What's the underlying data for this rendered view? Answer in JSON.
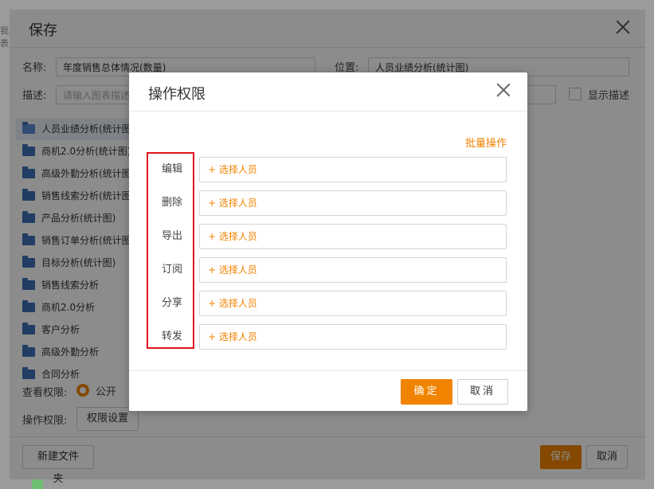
{
  "background": {
    "left_fragment": "我表"
  },
  "save_dialog": {
    "title": "保存",
    "name_label": "名称:",
    "name_value": "年度销售总体情况(数量)",
    "location_label": "位置:",
    "location_value": "人员业绩分析(统计图)",
    "desc_label": "描述:",
    "desc_placeholder": "请输入图表描述",
    "show_desc_label": "显示描述",
    "tree_items": [
      {
        "label": "人员业绩分析(统计图",
        "selected": true
      },
      {
        "label": "商机2.0分析(统计图)"
      },
      {
        "label": "高级外勤分析(统计图"
      },
      {
        "label": "销售线索分析(统计图"
      },
      {
        "label": "产品分析(统计图)"
      },
      {
        "label": "销售订单分析(统计图"
      },
      {
        "label": "目标分析(统计图)"
      },
      {
        "label": "销售线索分析"
      },
      {
        "label": "商机2.0分析"
      },
      {
        "label": "客户分析"
      },
      {
        "label": "高级外勤分析"
      },
      {
        "label": "合同分析"
      }
    ],
    "view_perm_label": "查看权限:",
    "view_perm_option": "公开",
    "op_perm_label": "操作权限:",
    "perm_settings_button": "权限设置",
    "new_folder_button": "新建文件夹",
    "save_button": "保存",
    "cancel_button": "取消"
  },
  "perm_modal": {
    "title": "操作权限",
    "batch_link": "批量操作",
    "rows": [
      {
        "label": "编辑",
        "placeholder": "+ 选择人员"
      },
      {
        "label": "删除",
        "placeholder": "+ 选择人员"
      },
      {
        "label": "导出",
        "placeholder": "+ 选择人员"
      },
      {
        "label": "订阅",
        "placeholder": "+ 选择人员"
      },
      {
        "label": "分享",
        "placeholder": "+ 选择人员"
      },
      {
        "label": "转发",
        "placeholder": "+ 选择人员"
      }
    ],
    "ok_button": "确定",
    "cancel_button": "取消"
  },
  "colors": {
    "accent": "#f08300",
    "highlight_box": "#e0141e"
  }
}
